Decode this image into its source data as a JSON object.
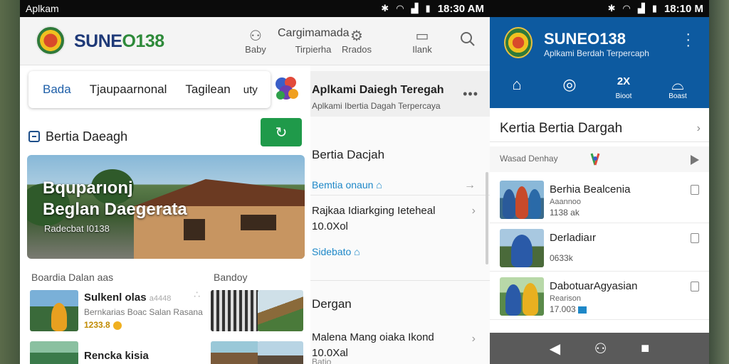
{
  "status_left": {
    "carrier": "Aplkam",
    "time": "18:30 AM"
  },
  "status_right": {
    "time": "18:10 M"
  },
  "left": {
    "brand_a": "SUNE",
    "brand_b": "O138",
    "nav": [
      {
        "label": "Baby",
        "icon": "people-icon"
      },
      {
        "label": "Tirpierha",
        "icon": "category-icon"
      },
      {
        "label": "Rrados",
        "icon": "settings-icon"
      },
      {
        "label": "Ilank",
        "icon": "video-icon"
      }
    ],
    "nav_heading": "Cargimamada",
    "tabs": [
      "Bada",
      "Tjaupaarnonal",
      "Tagilean",
      "uty"
    ],
    "section_title": "Bertia Daeagh",
    "hero_title_1": "Bquparıonj",
    "hero_title_2": "Beglan Daegerata",
    "hero_sub": "Radecbat I0138",
    "list_label": "Boardia Dalan aas",
    "list_label_right": "Bandoy",
    "items": [
      {
        "title": "Sulkenl olas",
        "badge": "a4448",
        "sub": "Bernkarias Boac Salan Rasana",
        "meta": "1233.8"
      },
      {
        "title": "Rencka kisia",
        "badge": "",
        "sub": "",
        "meta": ""
      }
    ]
  },
  "mid": {
    "top_title": "Aplkami Daiegh Teregah",
    "top_sub": "Aplkami Ibertia Dagah Terpercaya",
    "heading1": "Bertia Dacjah",
    "link1": "Bemtia onaun",
    "text1_a": "Rajkaa Idiarkging Ieteheal",
    "text1_b": "10.0Xol",
    "link2": "Sidebato",
    "heading2": "Dergan",
    "text2_a": "Malena Mang oiaka Ikond",
    "text2_b": "10.0Xal",
    "footer": "Batio"
  },
  "right": {
    "brand": "SUNEO138",
    "tagline": "Aplkami Berdah Terpercaph",
    "nav": [
      {
        "label": "",
        "icon": "home-icon"
      },
      {
        "label": "",
        "icon": "compass-icon"
      },
      {
        "label": "Bioot",
        "icon": "code-icon"
      },
      {
        "label": "Boast",
        "icon": "hat-icon"
      }
    ],
    "nav_2x": "2X",
    "title": "Kertia Bertia Dargah",
    "sub": "Wasad Denhay",
    "items": [
      {
        "title": "Berhia Bealcenia",
        "sub": "Aaannoo",
        "meta": "1138 ak"
      },
      {
        "title": "Derladiaır",
        "sub": "",
        "meta": "0633k"
      },
      {
        "title": "DabotuarAgyasian",
        "sub": "Rearison",
        "meta": "17.003"
      }
    ]
  }
}
